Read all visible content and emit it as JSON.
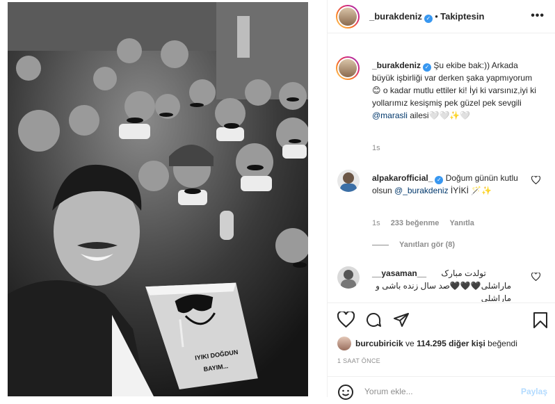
{
  "post": {
    "author": "_burakdeniz",
    "follow_state": "Takiptesin",
    "separator": "•",
    "more_icon": "more-options-icon",
    "verified_glyph": "✓"
  },
  "photo": {
    "cake_text_line1": "IYIKI DOĞDUN",
    "cake_text_line2": "BAYIM..."
  },
  "caption": {
    "username": "_burakdeniz",
    "text_part1": "Şu ekibe bak:)) Arkada büyük işbirliği var derken şaka yapmıyorum😊 o kadar mutlu ettiler ki! İyi ki varsınız,iyi ki yollarımız kesişmiş pek güzel pek sevgili ",
    "mention": "@marasli",
    "text_part2": " ailesi🤍🤍✨🤍",
    "time": "1s"
  },
  "comments": [
    {
      "username": "alpakarofficial_",
      "text_part1": "Doğum günün kutlu olsun ",
      "mention": "@_burakdeniz",
      "text_part2": " İYİKİ 🪄✨",
      "time": "1s",
      "likes": "233 beğenme",
      "reply": "Yanıtla",
      "view_replies": "Yanıtları gör (8)"
    },
    {
      "username": "__yasaman__",
      "line1": "تولدت مبارک",
      "line2": "ماراشلی🖤🖤🖤صد سال زنده باشی و",
      "line3": "ماراشلی"
    }
  ],
  "actions": {
    "liked_by_user": "burcubiricik",
    "likes_middle": "ve",
    "likes_count": "114.295 diğer kişi",
    "likes_suffix": "beğendi",
    "time_ago": "1 SAAT ÖNCE"
  },
  "add_comment": {
    "placeholder": "Yorum ekle...",
    "post_label": "Paylaş"
  }
}
